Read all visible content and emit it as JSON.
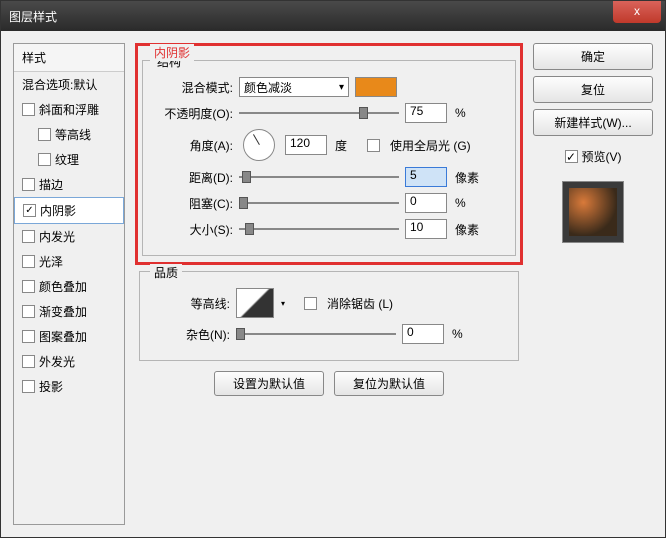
{
  "window": {
    "title": "图层样式"
  },
  "close_x": "x",
  "sidebar": {
    "header": "样式",
    "blend_opts": "混合选项:默认",
    "items": [
      {
        "label": "斜面和浮雕",
        "checked": false
      },
      {
        "label": "等高线",
        "checked": false,
        "indent": true
      },
      {
        "label": "纹理",
        "checked": false,
        "indent": true
      },
      {
        "label": "描边",
        "checked": false
      },
      {
        "label": "内阴影",
        "checked": true,
        "selected": true
      },
      {
        "label": "内发光",
        "checked": false
      },
      {
        "label": "光泽",
        "checked": false
      },
      {
        "label": "颜色叠加",
        "checked": false
      },
      {
        "label": "渐变叠加",
        "checked": false
      },
      {
        "label": "图案叠加",
        "checked": false
      },
      {
        "label": "外发光",
        "checked": false
      },
      {
        "label": "投影",
        "checked": false
      }
    ]
  },
  "main": {
    "section_red": "内阴影",
    "structure": {
      "legend": "结构",
      "blend_mode_label": "混合模式:",
      "blend_mode_value": "颜色减淡",
      "swatch_color": "#e8891a",
      "opacity_label": "不透明度(O):",
      "opacity_value": "75",
      "opacity_unit": "%",
      "angle_label": "角度(A):",
      "angle_value": "120",
      "angle_unit": "度",
      "global_light_label": "使用全局光 (G)",
      "distance_label": "距离(D):",
      "distance_value": "5",
      "distance_unit": "像素",
      "choke_label": "阻塞(C):",
      "choke_value": "0",
      "choke_unit": "%",
      "size_label": "大小(S):",
      "size_value": "10",
      "size_unit": "像素"
    },
    "quality": {
      "legend": "品质",
      "contour_label": "等高线:",
      "antialias_label": "消除锯齿 (L)",
      "noise_label": "杂色(N):",
      "noise_value": "0",
      "noise_unit": "%"
    },
    "default_btn": "设置为默认值",
    "reset_btn": "复位为默认值"
  },
  "right": {
    "ok": "确定",
    "cancel": "复位",
    "new_style": "新建样式(W)...",
    "preview_label": "预览(V)",
    "preview_checked": "✓"
  }
}
